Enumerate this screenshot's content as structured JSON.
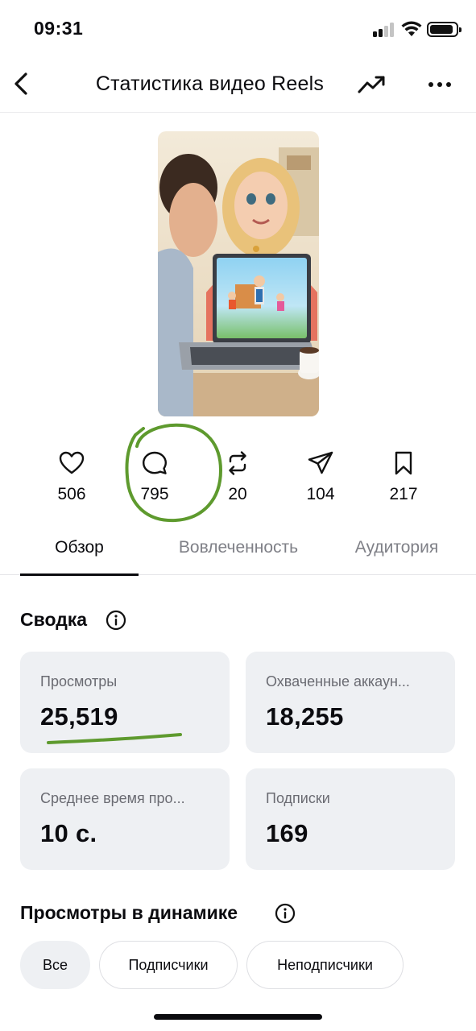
{
  "status_bar": {
    "time": "09:31"
  },
  "header": {
    "title": "Статистика видео Reels"
  },
  "metrics": [
    {
      "icon": "heart-icon",
      "value": "506"
    },
    {
      "icon": "comment-icon",
      "value": "795"
    },
    {
      "icon": "repost-icon",
      "value": "20"
    },
    {
      "icon": "share-icon",
      "value": "104"
    },
    {
      "icon": "bookmark-icon",
      "value": "217"
    }
  ],
  "tabs": [
    {
      "label": "Обзор",
      "active": true
    },
    {
      "label": "Вовлеченность",
      "active": false
    },
    {
      "label": "Аудитория",
      "active": false
    }
  ],
  "summary": {
    "title": "Сводка",
    "cards": [
      {
        "label": "Просмотры",
        "value": "25,519"
      },
      {
        "label": "Охваченные аккаун...",
        "value": "18,255"
      },
      {
        "label": "Среднее время про...",
        "value": "10 с."
      },
      {
        "label": "Подписки",
        "value": "169"
      }
    ]
  },
  "views_dynamics": {
    "title": "Просмотры в динамике",
    "filters": [
      {
        "label": "Все",
        "selected": true
      },
      {
        "label": "Подписчики",
        "selected": false
      },
      {
        "label": "Неподписчики",
        "selected": false
      }
    ]
  },
  "colors": {
    "text": "#0b0b0f",
    "muted": "#7f8087",
    "card_bg": "#eef0f3",
    "annotation_green": "#5e9a2e"
  }
}
